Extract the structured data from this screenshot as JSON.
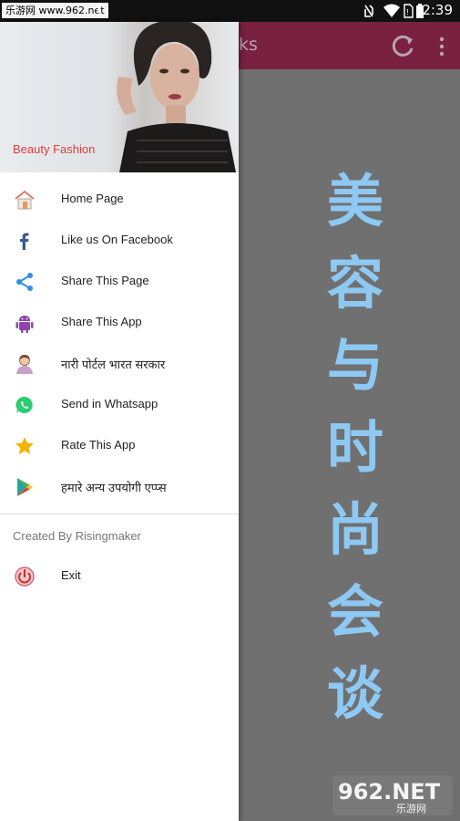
{
  "status_bar": {
    "watermark": "乐游网 www.962.net",
    "time": "2:39",
    "icons": [
      "warning-icon",
      "no-sim-icon",
      "wifi-icon",
      "battery-icon"
    ]
  },
  "app_bar": {
    "title_fragment": "ks",
    "accent_color": "#7a2140",
    "actions": [
      "refresh-icon",
      "more-icon"
    ]
  },
  "content": {
    "vertical_title": [
      "美",
      "容",
      "与",
      "时",
      "尚",
      "会",
      "谈"
    ],
    "title_color": "#8ec9f4"
  },
  "drawer": {
    "header_label": "Beauty Fashion",
    "items": [
      {
        "label": "Home Page",
        "icon": "home-icon"
      },
      {
        "label": "Like us On Facebook",
        "icon": "facebook-icon"
      },
      {
        "label": "Share This Page",
        "icon": "share-icon"
      },
      {
        "label": "Share This App",
        "icon": "android-icon"
      },
      {
        "label": "नारी पोर्टल भारत सरकार",
        "icon": "woman-icon"
      },
      {
        "label": "Send in Whatsapp",
        "icon": "whatsapp-icon"
      },
      {
        "label": "Rate This App",
        "icon": "star-icon"
      },
      {
        "label": "हमारे अन्य उपयोगी एप्प्स",
        "icon": "play-store-icon"
      }
    ],
    "created_by": "Created By Risingmaker",
    "exit_label": "Exit"
  },
  "bottom_watermark": {
    "brand": "962.NET",
    "subtitle": "乐游网"
  }
}
